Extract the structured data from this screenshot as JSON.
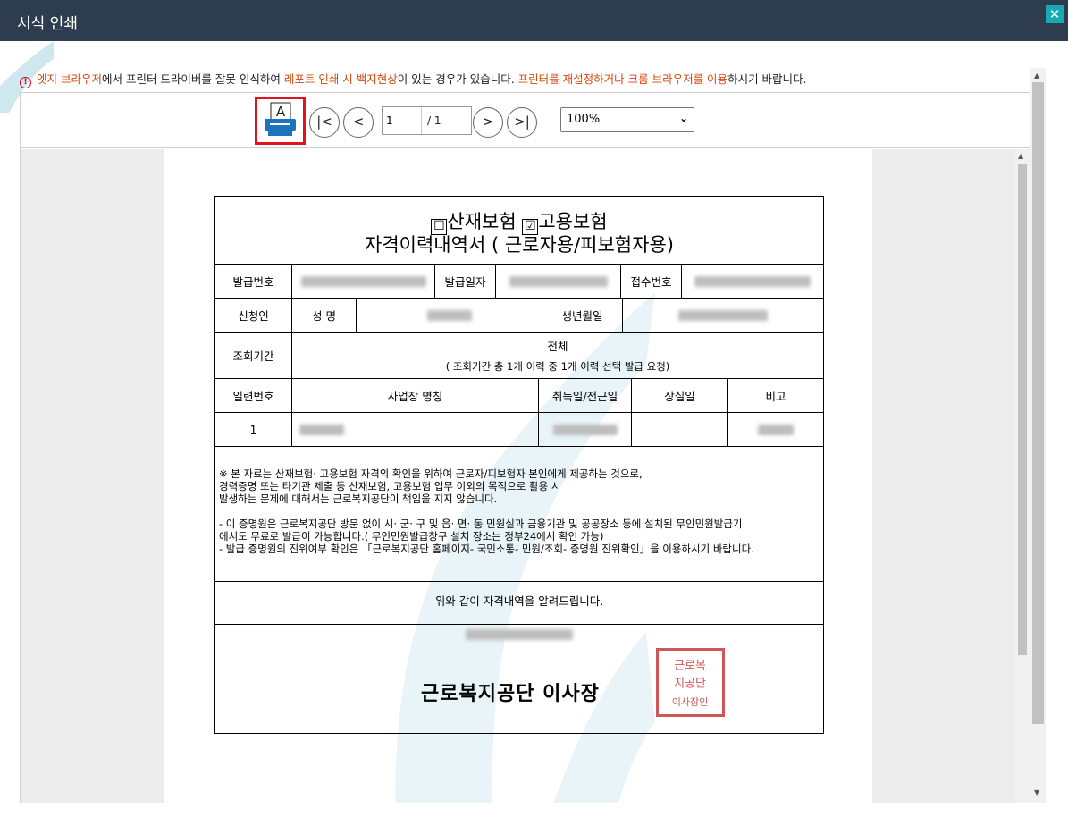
{
  "window": {
    "title": "서식 인쇄",
    "close_symbol": "✕"
  },
  "notice": {
    "icon": "!",
    "segments": [
      {
        "text": "엣지 브라우저",
        "highlight": true
      },
      {
        "text": "에서 프린터 드라이버를 잘못 인식하여 ",
        "highlight": false
      },
      {
        "text": "레포트 인쇄 시 백지현상",
        "highlight": true
      },
      {
        "text": "이 있는 경우가 있습니다. ",
        "highlight": false
      },
      {
        "text": "프린터를 재설정하거나 크롬 브라우저를 이용",
        "highlight": true
      },
      {
        "text": "하시기 바랍니다.",
        "highlight": false
      }
    ]
  },
  "toolbar": {
    "print_icon_letter": "A",
    "first_symbol": "|<",
    "prev_symbol": "<",
    "next_symbol": ">",
    "last_symbol": ">|",
    "page_current": "1",
    "page_total": "/ 1",
    "zoom": "100%"
  },
  "document": {
    "checkbox_industrial": "☐",
    "label_industrial": "산재보험",
    "checkbox_employment": "☑",
    "label_employment": "고용보험",
    "title": "자격이력내역서 ( 근로자용/피보험자용)",
    "row1": {
      "issue_no_label": "발급번호",
      "issue_date_label": "발급일자",
      "receipt_no_label": "접수번호"
    },
    "row2": {
      "applicant_label": "신청인",
      "name_label": "성 명",
      "birth_label": "생년월일"
    },
    "row3": {
      "period_label": "조회기간",
      "period_value": "전체",
      "period_note": "( 조회기간 총  1개 이력 중 1개 이력 선택 발급 요청)"
    },
    "headers": {
      "seq": "일련번호",
      "workplace": "사업장 명칭",
      "acquired": "취득일/전근일",
      "lost": "상실일",
      "remark": "비고"
    },
    "data_row": {
      "seq": "1"
    },
    "notes": [
      "※ 본 자료는 산재보험· 고용보험 자격의 확인을 위하여 근로자/피보험자 본인에게 제공하는 것으로,",
      "   경력증명 또는 타기관 제출 등 산재보험, 고용보험 업무 이외의 목적으로 활용 시",
      "   발생하는 문제에 대해서는 근로복지공단이 책임을 지지 않습니다.",
      "",
      "-  이 증명원은 근로복지공단 방문 없이 시· 군· 구 및 읍· 면· 동 민원실과 금융기관 및 공공장소 등에 설치된 무인민원발급기",
      "   에서도 무료로 발급이 가능합니다.( 무인민원발급창구 설치 장소는 정부24에서 확인 가능)",
      "-  발급 증명원의 진위여부 확인은 「근로복지공단 홈페이지- 국민소통- 민원/조회- 증명원 진위확인」을 이용하시기 바랍니다."
    ],
    "confirm_text": "위와 같이 자격내역을 알려드립니다.",
    "agency": "근로복지공단  이사장",
    "seal_text": "근로복지공단이사장인"
  },
  "colors": {
    "titlebar": "#2d3d4f",
    "close": "#18a9b6",
    "highlight": "#d9480f",
    "print_frame": "#e3121b",
    "print_icon": "#1a75bb",
    "seal": "#c83a3a"
  }
}
